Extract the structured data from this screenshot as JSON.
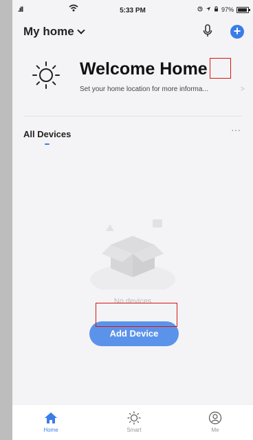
{
  "status_bar": {
    "signal": ".ıll",
    "time": "5:33 PM",
    "battery_text": "97%"
  },
  "header": {
    "home_name": "My home"
  },
  "welcome": {
    "title": "Welcome Home",
    "subtitle": "Set your home location for more informa...",
    "arrow": ">"
  },
  "devices": {
    "tab_label": "All Devices",
    "more_label": "···",
    "empty_text": "No devices",
    "add_button_label": "Add Device"
  },
  "bottom_nav": [
    {
      "label": "Home",
      "icon": "home-icon",
      "active": true
    },
    {
      "label": "Smart",
      "icon": "sun-icon",
      "active": false
    },
    {
      "label": "Me",
      "icon": "user-icon",
      "active": false
    }
  ],
  "colors": {
    "accent": "#3a7de8",
    "button": "#5c93ea",
    "annotation": "#dd1111"
  }
}
